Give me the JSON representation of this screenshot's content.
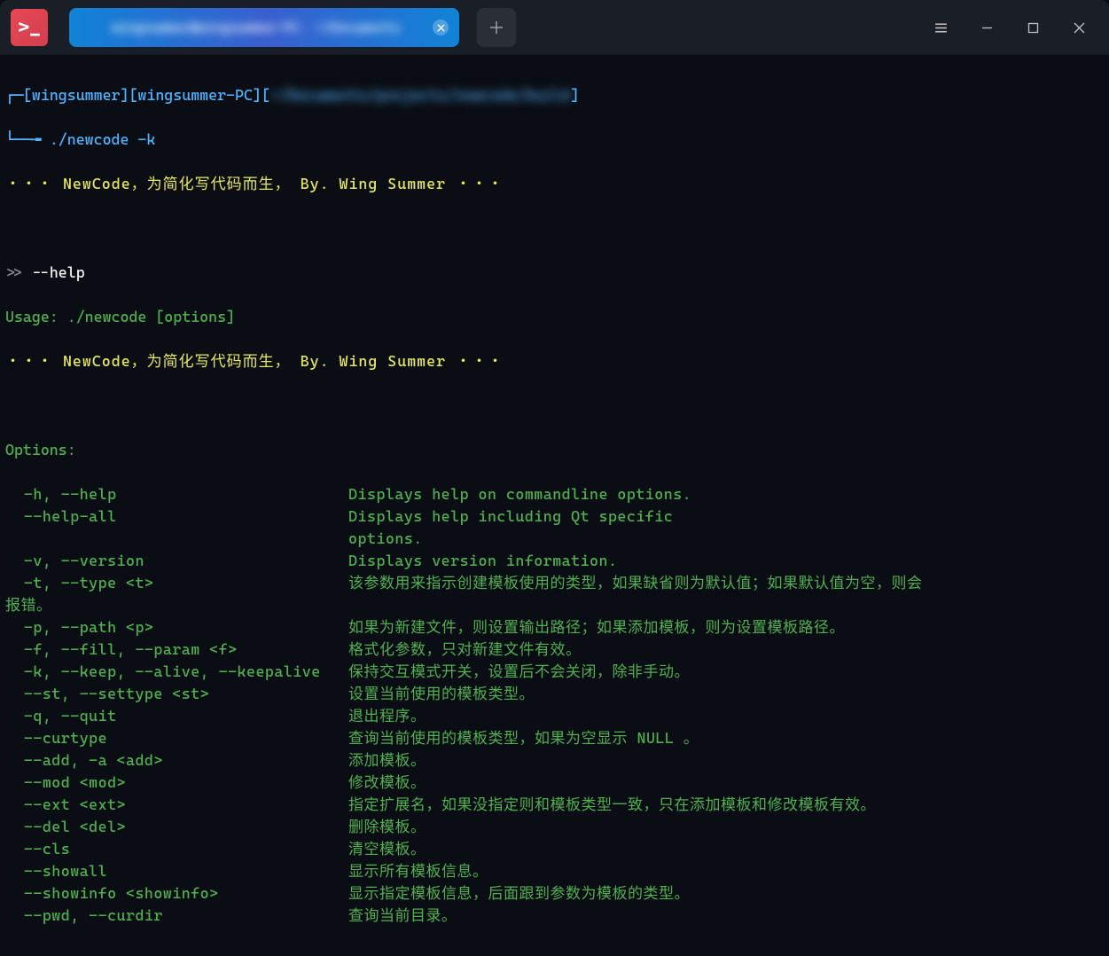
{
  "app": {
    "icon_glyph": ">_"
  },
  "tab": {
    "title": "wingsummer@wingsummer-PC: ~/Documents"
  },
  "prompt": {
    "decor_top": "┌─",
    "user": "wingsummer",
    "host": "wingsummer-PC",
    "path": "~/Documents/projects/newcode/build",
    "decor_bottom": "└──╼",
    "command": "./newcode -k"
  },
  "banner1": "・・・ NewCode，为简化写代码而生， By. Wing Summer ・・・",
  "help_input": {
    "prompt": ">>",
    "cmd": "--help"
  },
  "usage": "Usage: ./newcode [options]",
  "banner2": "・・・ NewCode，为简化写代码而生， By. Wing Summer ・・・",
  "options_header": "Options:",
  "options": [
    {
      "flag": "  -h, --help",
      "desc": "Displays help on commandline options."
    },
    {
      "flag": "  --help-all",
      "desc": "Displays help including Qt specific"
    },
    {
      "flag": "",
      "desc": "options."
    },
    {
      "flag": "  -v, --version",
      "desc": "Displays version information."
    },
    {
      "flag": "  -t, --type <t>",
      "desc": "该参数用来指示创建模板使用的类型，如果缺省则为默认值；如果默认值为空，则会"
    },
    {
      "flag": "报错。",
      "desc": "",
      "wrapped": true
    },
    {
      "flag": "  -p, --path <p>",
      "desc": "如果为新建文件，则设置输出路径；如果添加模板，则为设置模板路径。"
    },
    {
      "flag": "  -f, --fill, --param <f>",
      "desc": "格式化参数，只对新建文件有效。"
    },
    {
      "flag": "  -k, --keep, --alive, --keepalive",
      "desc": "保持交互模式开关，设置后不会关闭，除非手动。"
    },
    {
      "flag": "  --st, --settype <st>",
      "desc": "设置当前使用的模板类型。"
    },
    {
      "flag": "  -q, --quit",
      "desc": "退出程序。"
    },
    {
      "flag": "  --curtype",
      "desc": "查询当前使用的模板类型，如果为空显示 NULL 。"
    },
    {
      "flag": "  --add, -a <add>",
      "desc": "添加模板。"
    },
    {
      "flag": "  --mod <mod>",
      "desc": "修改模板。"
    },
    {
      "flag": "  --ext <ext>",
      "desc": "指定扩展名，如果没指定则和模板类型一致，只在添加模板和修改模板有效。"
    },
    {
      "flag": "  --del <del>",
      "desc": "删除模板。"
    },
    {
      "flag": "  --cls",
      "desc": "清空模板。"
    },
    {
      "flag": "  --showall",
      "desc": "显示所有模板信息。"
    },
    {
      "flag": "  --showinfo <showinfo>",
      "desc": "显示指定模板信息，后面跟到参数为模板的类型。"
    },
    {
      "flag": "  --pwd, --curdir",
      "desc": "查询当前目录。"
    }
  ]
}
